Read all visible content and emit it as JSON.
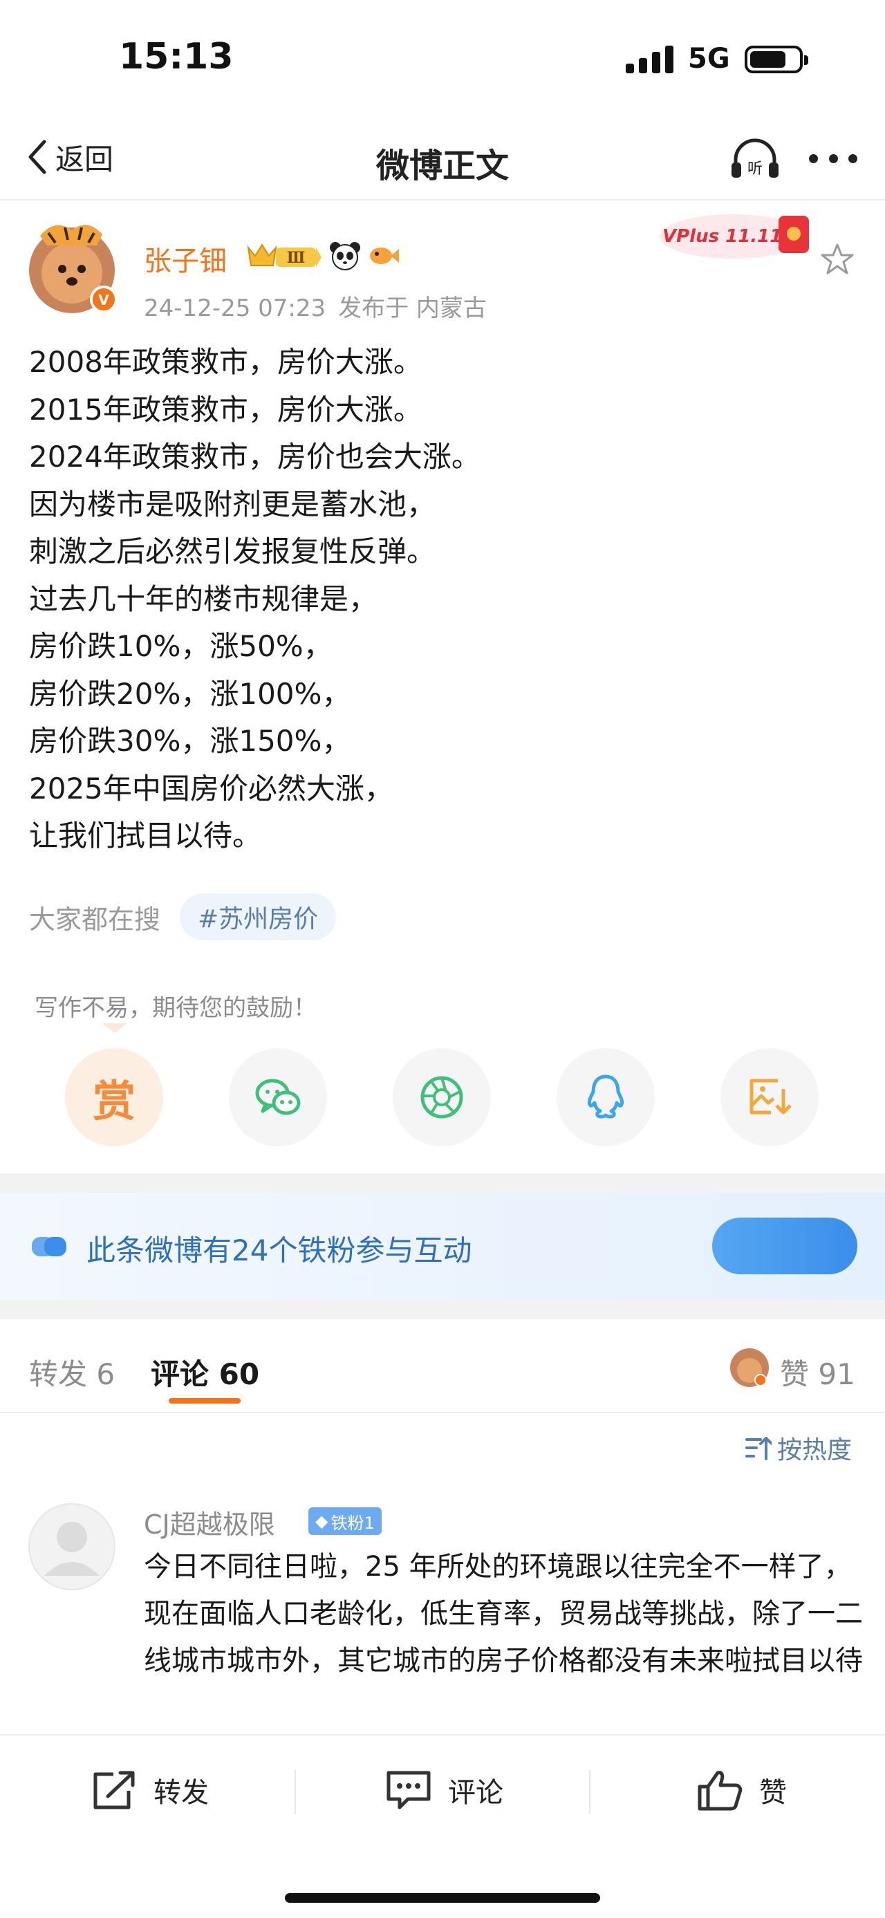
{
  "status_bar": {
    "time": "15:13",
    "network": "5G",
    "battery_percent": 75
  },
  "nav": {
    "back_label": "返回",
    "title": "微博正文",
    "listen_label": "听"
  },
  "author": {
    "name": "张子钿",
    "level_badge": "Ⅲ",
    "verified_mark": "V",
    "time": "24-12-25 07:23",
    "location": "发布于 内蒙古",
    "promo_badge": "VPlus 11.11"
  },
  "post": {
    "lines": [
      "2008年政策救市，房价大涨。",
      "2015年政策救市，房价大涨。",
      "2024年政策救市，房价也会大涨。",
      "因为楼市是吸附剂更是蓄水池，",
      "刺激之后必然引发报复性反弹。",
      "过去几十年的楼市规律是，",
      "房价跌10%，涨50%，",
      "房价跌20%，涨100%，",
      "房价跌30%，涨150%，",
      "2025年中国房价必然大涨，",
      "让我们拭目以待。"
    ]
  },
  "search": {
    "label": "大家都在搜",
    "tag": "#苏州房价"
  },
  "tip": {
    "prompt": "写作不易，期待您的鼓励！",
    "button": "赏"
  },
  "share_icons": [
    "wechat-icon",
    "moments-icon",
    "qq-icon",
    "save-image-icon"
  ],
  "fans_banner": {
    "text": "此条微博有24个铁粉参与互动"
  },
  "tabs": {
    "repost": "转发 6",
    "comments": "评论 60",
    "likes": "赞 91"
  },
  "sort": {
    "label": "按热度"
  },
  "comment": {
    "user": "CJ超越极限",
    "badge": "铁粉1",
    "text": "今日不同往日啦，25 年所处的环境跟以往完全不一样了，现在面临人口老龄化，低生育率，贸易战等挑战，除了一二线城市城市外，其它城市的房子价格都没有未来啦拭目以待"
  },
  "bottom_bar": {
    "repost": "转发",
    "comment": "评论",
    "like": "赞"
  },
  "colors": {
    "accent": "#f5741a",
    "link": "#5b7ea8",
    "banner_text": "#2f6fbf"
  }
}
